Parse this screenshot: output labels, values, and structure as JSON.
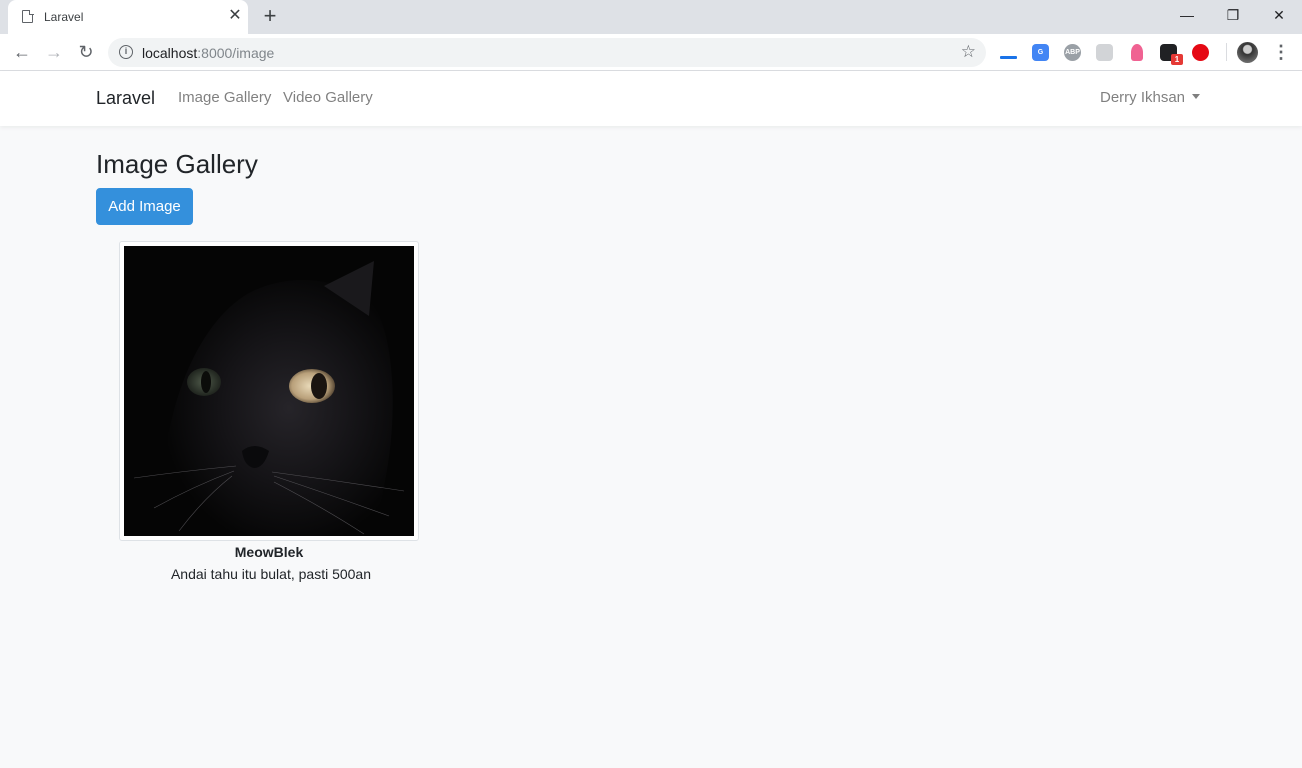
{
  "browser": {
    "tab_title": "Laravel",
    "url_host": "localhost",
    "url_path": ":8000/image",
    "extension_badge": "1",
    "extensions": [
      "google-translate",
      "adblock-plus",
      "extension",
      "pink-extension",
      "badge-extension",
      "red-extension"
    ]
  },
  "navbar": {
    "brand": "Laravel",
    "links": [
      "Image Gallery",
      "Video Gallery"
    ],
    "user_name": "Derry Ikhsan"
  },
  "page": {
    "title": "Image Gallery",
    "add_button": "Add Image"
  },
  "gallery": {
    "items": [
      {
        "title": "MeowBlek",
        "description": "Andai tahu itu bulat, pasti 500an"
      }
    ]
  },
  "colors": {
    "primary": "#3490dc",
    "page_background": "#f8f9fa",
    "navbar_background": "#ffffff"
  }
}
